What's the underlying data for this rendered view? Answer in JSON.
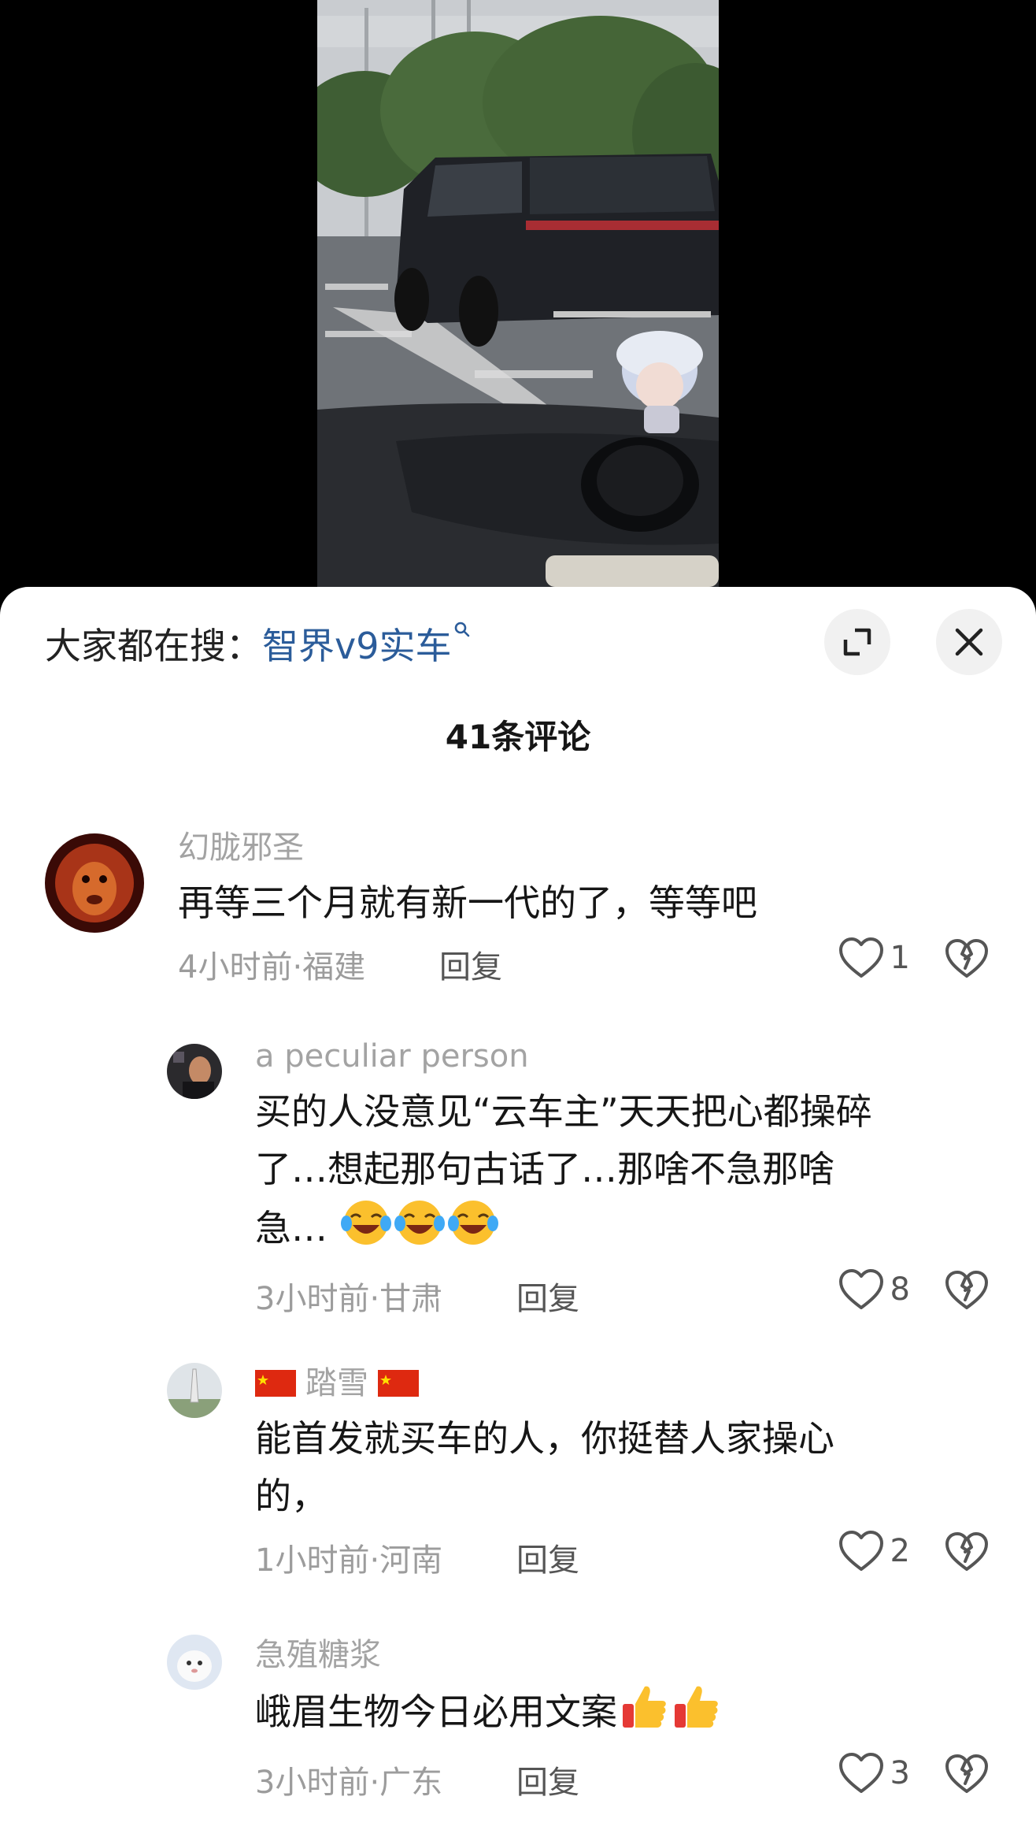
{
  "search": {
    "prefix": "大家都在搜：",
    "term": "智界v9实车"
  },
  "comment_count": "41条评论",
  "comments": [
    {
      "user": "幻胧邪圣",
      "text": "再等三个月就有新一代的了，等等吧",
      "time": "4小时前·福建",
      "reply": "回复",
      "likes": "1"
    },
    {
      "user": "a peculiar person",
      "text_lines": [
        "买的人没意见“云车主”天天把心都操碎",
        "了…想起那句古话了…那啥不急那啥",
        "急…"
      ],
      "time": "3小时前·甘肃",
      "reply": "回复",
      "likes": "8"
    },
    {
      "user": "踏雪",
      "text_lines": [
        "能首发就买车的人，你挺替人家操心",
        "的，"
      ],
      "time": "1小时前·河南",
      "reply": "回复",
      "likes": "2"
    },
    {
      "user": "急殖糖浆",
      "text": "峨眉生物今日必用文案",
      "time": "3小时前·广东",
      "reply": "回复",
      "likes": "3"
    }
  ],
  "icons": [
    "search-icon",
    "expand-icon",
    "close-icon",
    "heart-icon",
    "broken-heart-icon",
    "crying-laughing-emoji",
    "thumbs-up-emoji",
    "china-flag-icon"
  ],
  "colors": {
    "search_term": "#2b5c9a",
    "username": "#a3a3a3",
    "text": "#161616",
    "meta": "#9c9c9c"
  }
}
